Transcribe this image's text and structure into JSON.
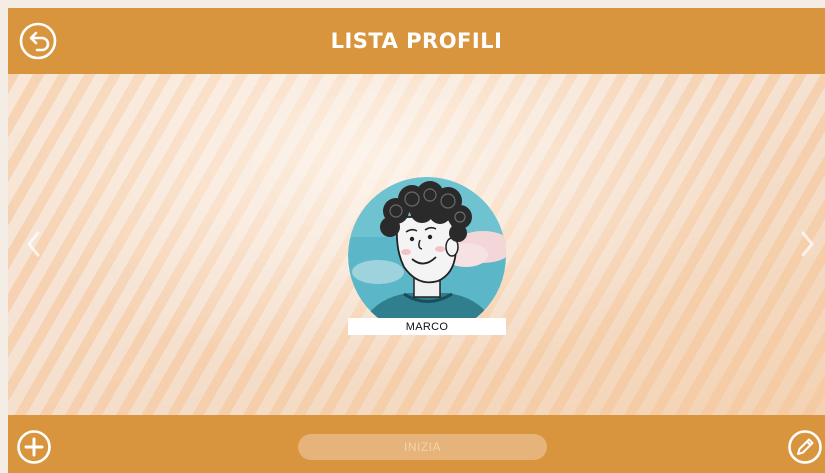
{
  "header": {
    "title": "LISTA PROFILI",
    "back_icon": "back-arrow-icon"
  },
  "profiles": [
    {
      "name": "MARCO",
      "avatar": "boy-avatar-illustration"
    }
  ],
  "nav": {
    "prev_icon": "chevron-left-icon",
    "next_icon": "chevron-right-icon"
  },
  "footer": {
    "add_icon": "plus-circle-icon",
    "start_label": "INIZIA",
    "edit_icon": "pencil-icon"
  },
  "colors": {
    "bar": "#d9953e",
    "start_button": "#e6b37a",
    "start_text": "#f3d3ad",
    "background": "#f5e2d2"
  }
}
